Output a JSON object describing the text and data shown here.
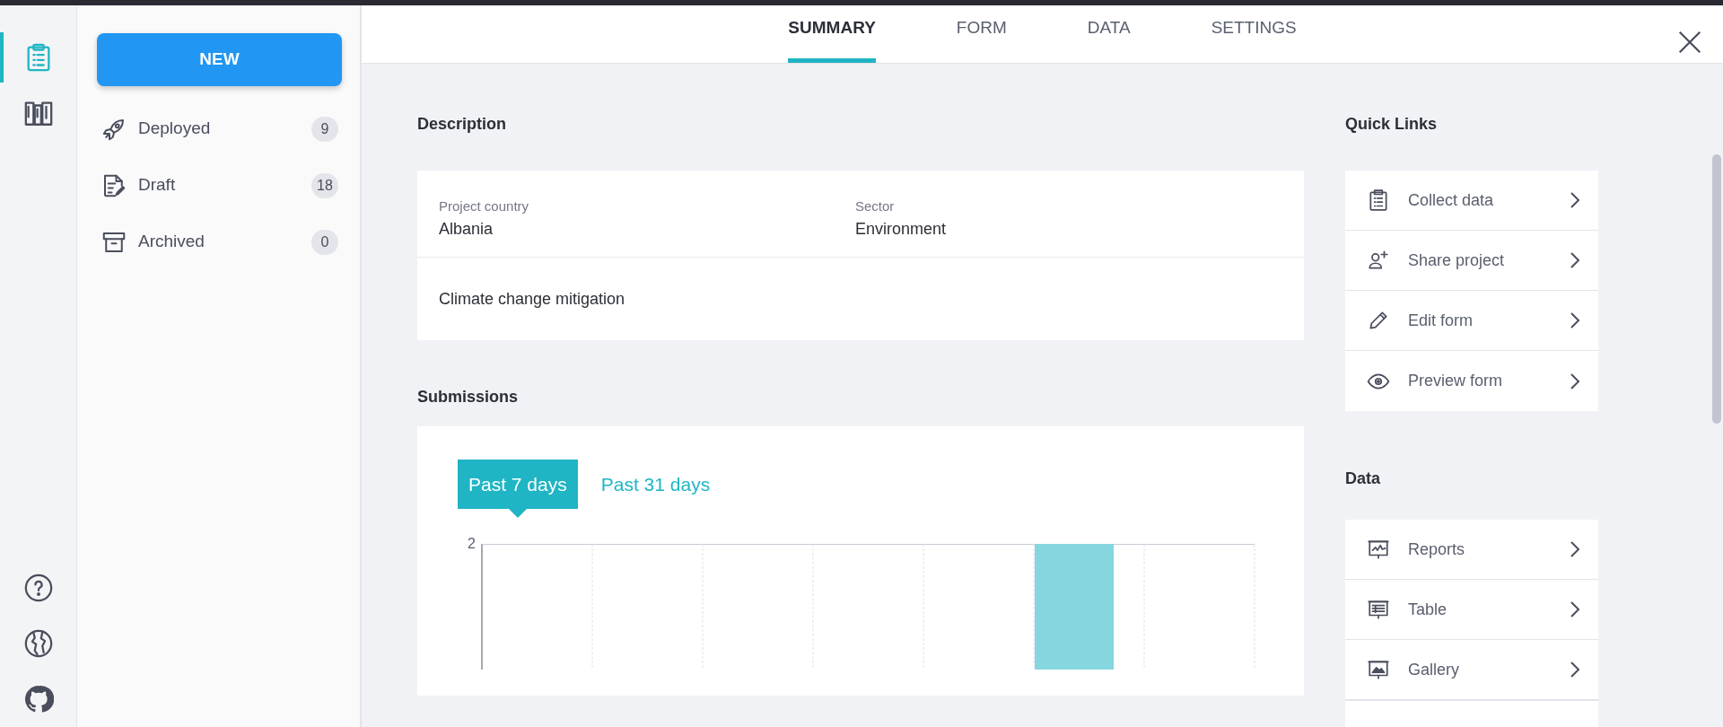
{
  "rail": {
    "top_items": [
      {
        "kind": "forms",
        "selected": true
      },
      {
        "kind": "library",
        "selected": false
      }
    ],
    "bottom_items": [
      {
        "kind": "help"
      },
      {
        "kind": "globe"
      },
      {
        "kind": "github"
      }
    ]
  },
  "sidebar": {
    "new_button": "NEW",
    "items": [
      {
        "kind": "deployed",
        "label": "Deployed",
        "count": "9"
      },
      {
        "kind": "draft",
        "label": "Draft",
        "count": "18"
      },
      {
        "kind": "archived",
        "label": "Archived",
        "count": "0"
      }
    ]
  },
  "tabs": [
    {
      "label": "SUMMARY",
      "selected": true
    },
    {
      "label": "FORM",
      "selected": false
    },
    {
      "label": "DATA",
      "selected": false
    },
    {
      "label": "SETTINGS",
      "selected": false
    }
  ],
  "description": {
    "heading": "Description",
    "fields": [
      {
        "label": "Project country",
        "value": "Albania"
      },
      {
        "label": "Sector",
        "value": "Environment"
      }
    ],
    "note": "Climate change mitigation"
  },
  "submissions": {
    "heading": "Submissions",
    "periods": [
      {
        "label": "Past 7 days",
        "selected": true
      },
      {
        "label": "Past 31 days",
        "selected": false
      }
    ],
    "y_tick_label": "2"
  },
  "quick_links": {
    "heading": "Quick Links",
    "items": [
      {
        "kind": "collect",
        "label": "Collect data"
      },
      {
        "kind": "share",
        "label": "Share project"
      },
      {
        "kind": "edit",
        "label": "Edit form"
      },
      {
        "kind": "preview",
        "label": "Preview form"
      }
    ]
  },
  "data_links": {
    "heading": "Data",
    "items": [
      {
        "kind": "reports",
        "label": "Reports"
      },
      {
        "kind": "table",
        "label": "Table"
      },
      {
        "kind": "gallery",
        "label": "Gallery"
      }
    ]
  }
}
